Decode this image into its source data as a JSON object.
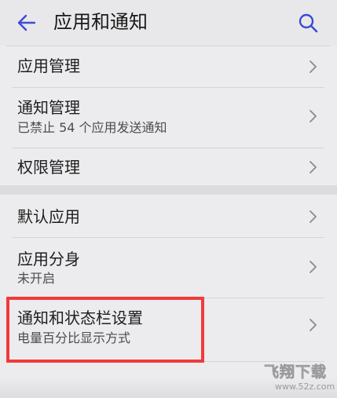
{
  "header": {
    "title": "应用和通知",
    "back_icon": "arrow-left-icon",
    "search_icon": "search-icon"
  },
  "items": [
    {
      "title": "应用管理",
      "subtitle": ""
    },
    {
      "title": "通知管理",
      "subtitle": "已禁止 54 个应用发送通知"
    },
    {
      "title": "权限管理",
      "subtitle": ""
    },
    {
      "title": "默认应用",
      "subtitle": ""
    },
    {
      "title": "应用分身",
      "subtitle": "未开启"
    },
    {
      "title": "通知和状态栏设置",
      "subtitle": "电量百分比显示方式"
    }
  ],
  "watermark": {
    "logo": "飞翔下载",
    "url": "www.52z.com"
  },
  "colors": {
    "accent": "#3c4bd6",
    "highlight": "#ef3b3b",
    "background": "#ececee"
  }
}
